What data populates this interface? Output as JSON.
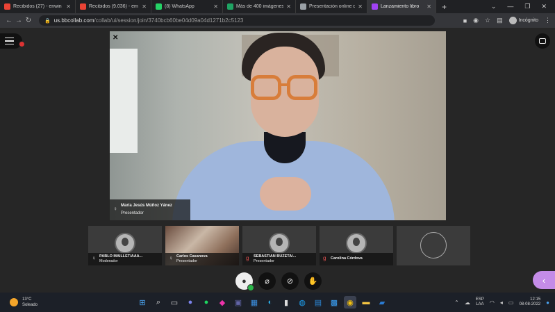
{
  "browser": {
    "tabs": [
      {
        "label": "Recibidos (27) - enwin",
        "color": "#ea4335",
        "active": false
      },
      {
        "label": "Recibidos (9.036) - em",
        "color": "#ea4335",
        "active": false
      },
      {
        "label": "(8) WhatsApp",
        "color": "#25d366",
        "active": false
      },
      {
        "label": "Más de 400 imágenes",
        "color": "#1fa463",
        "active": false
      },
      {
        "label": "Presentación online d",
        "color": "#9aa0a6",
        "active": false
      },
      {
        "label": "Lanzamiento libro",
        "color": "#a142f4",
        "active": true
      }
    ],
    "new_tab": "+",
    "url_domain": "us.bbcollab.com",
    "url_path": "/collab/ui/session/join/3740bcb60be04d09a04d1271b2c5123",
    "profile": "Incógnito"
  },
  "session": {
    "main_speaker": {
      "name": "María Jesús Múñoz Yánez",
      "role": "Presentador"
    },
    "participants": [
      {
        "name": "PABLO MAILLET/AAA...",
        "role": "Moderador",
        "type": "avatar",
        "mic": "on"
      },
      {
        "name": "Carlos Casanova",
        "role": "Presentador",
        "type": "camera",
        "mic": "on"
      },
      {
        "name": "SEBASTIAN BUZETA/...",
        "role": "Presentador",
        "type": "avatar",
        "mic": "off"
      },
      {
        "name": "Carolina Córdova",
        "role": "",
        "type": "avatar",
        "mic": "off"
      },
      {
        "name": "",
        "role": "",
        "type": "empty",
        "mic": ""
      }
    ]
  },
  "controls": {
    "icons": [
      "profile-icon",
      "mic-off-icon",
      "camera-off-icon",
      "raise-hand-icon"
    ]
  },
  "taskbar": {
    "weather_temp": "13°C",
    "weather_desc": "Soleado",
    "lang_top": "ESP",
    "lang_bottom": "LAA",
    "time": "12:15",
    "date": "08-08-2022"
  },
  "colors": {
    "accent": "#c48ce8",
    "ok_green": "#2bb64a",
    "mic_off": "#e05050"
  }
}
